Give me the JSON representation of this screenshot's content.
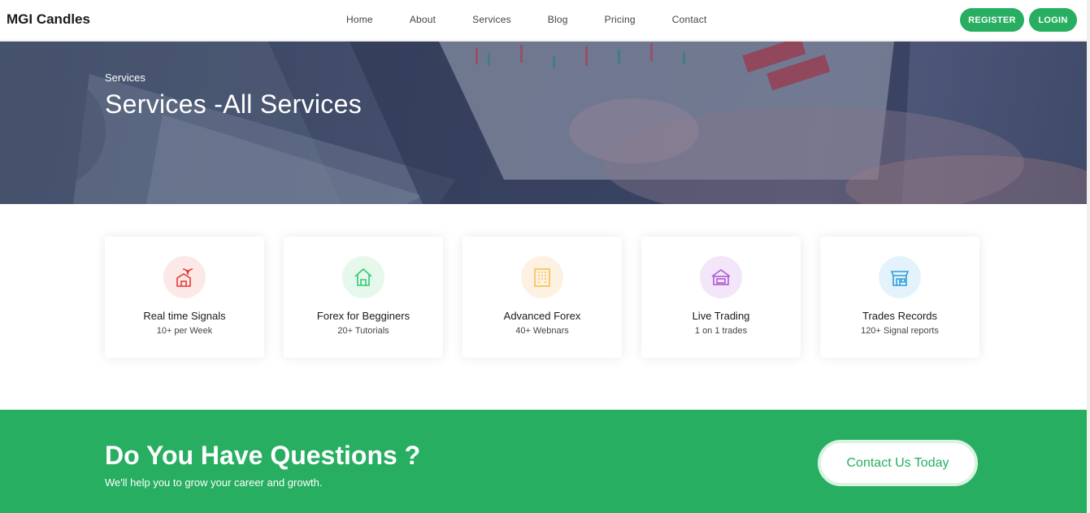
{
  "header": {
    "brand": "MGI Candles",
    "nav": [
      "Home",
      "About",
      "Services",
      "Blog",
      "Pricing",
      "Contact"
    ],
    "register_label": "REGISTER",
    "login_label": "LOGIN"
  },
  "hero": {
    "crumb": "Services",
    "title": "Services -All Services"
  },
  "services": [
    {
      "title": "Real time Signals",
      "sub": "10+ per Week",
      "icon": "palm-house-icon",
      "color": "#e53935",
      "bg": "#fde8e8"
    },
    {
      "title": "Forex for Begginers",
      "sub": "20+ Tutorials",
      "icon": "home-icon",
      "color": "#2ecc71",
      "bg": "#e6f8ec"
    },
    {
      "title": "Advanced Forex",
      "sub": "40+ Webnars",
      "icon": "building-icon",
      "color": "#f5c04a",
      "bg": "#fdf1e2"
    },
    {
      "title": "Live Trading",
      "sub": "1 on 1 trades",
      "icon": "house-frame-icon",
      "color": "#b15bd6",
      "bg": "#f3e6f8"
    },
    {
      "title": "Trades Records",
      "sub": "120+ Signal reports",
      "icon": "store-icon",
      "color": "#2d9cdb",
      "bg": "#e4f3fb"
    }
  ],
  "cta": {
    "title": "Do You Have Questions ?",
    "sub": "We'll help you to grow your career and growth.",
    "button": "Contact Us Today"
  },
  "colors": {
    "accent": "#27ae60"
  }
}
